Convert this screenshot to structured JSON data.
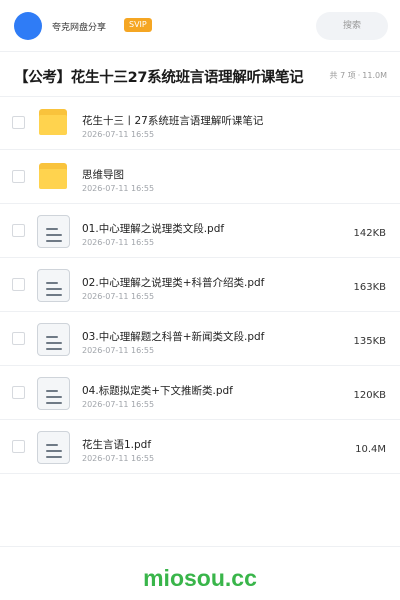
{
  "header": {
    "username": "夸克网盘分享",
    "badge": "SVIP",
    "search_label": "搜索"
  },
  "share": {
    "title": "【公考】花生十三27系统班言语理解听课笔记",
    "count": "共 7 项",
    "size": "11.0M"
  },
  "files": [
    {
      "type": "folder",
      "icon": "folder-icon",
      "name": "花生十三丨27系统班言语理解听课笔记",
      "date": "2026-07-11 16:55",
      "size": ""
    },
    {
      "type": "folder",
      "icon": "folder-icon",
      "name": "思维导图",
      "date": "2026-07-11 16:55",
      "size": ""
    },
    {
      "type": "file",
      "icon": "document-icon",
      "name": "01.中心理解之说理类文段.pdf",
      "date": "2026-07-11 16:55",
      "size": "142KB"
    },
    {
      "type": "file",
      "icon": "document-icon",
      "name": "02.中心理解之说理类+科普介绍类.pdf",
      "date": "2026-07-11 16:55",
      "size": "163KB"
    },
    {
      "type": "file",
      "icon": "document-icon",
      "name": "03.中心理解题之科普+新闻类文段.pdf",
      "date": "2026-07-11 16:55",
      "size": "135KB"
    },
    {
      "type": "file",
      "icon": "document-icon",
      "name": "04.标题拟定类+下文推断类.pdf",
      "date": "2026-07-11 16:55",
      "size": "120KB"
    },
    {
      "type": "file",
      "icon": "document-icon",
      "name": "花生言语1.pdf",
      "date": "2026-07-11 16:55",
      "size": "10.4M"
    }
  ],
  "footer": {
    "brand": "miosou.cc"
  },
  "colors": {
    "accent": "#2f7cf6",
    "svip": "#f5a623",
    "folder": "#ffd34e",
    "brand": "#39b54a"
  }
}
